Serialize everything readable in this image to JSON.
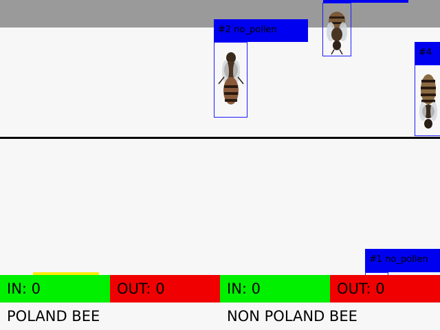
{
  "detections": [
    {
      "label": "#2 no_pollen"
    },
    {
      "label": "#4"
    },
    {
      "label": "#1 no_pollen"
    }
  ],
  "counters": {
    "poland": {
      "in_label": "IN:",
      "in_value": "0",
      "out_label": "OUT:",
      "out_value": "0",
      "title": "POLAND BEE"
    },
    "non_poland": {
      "in_label": "IN:",
      "in_value": "0",
      "out_label": "OUT:",
      "out_value": "0",
      "title": "NON POLAND BEE"
    }
  },
  "colors": {
    "in_panel": "#00f000",
    "out_panel": "#f00000",
    "detection": "#0000f0",
    "divider": "#000000",
    "highlight": "#ffea00"
  }
}
